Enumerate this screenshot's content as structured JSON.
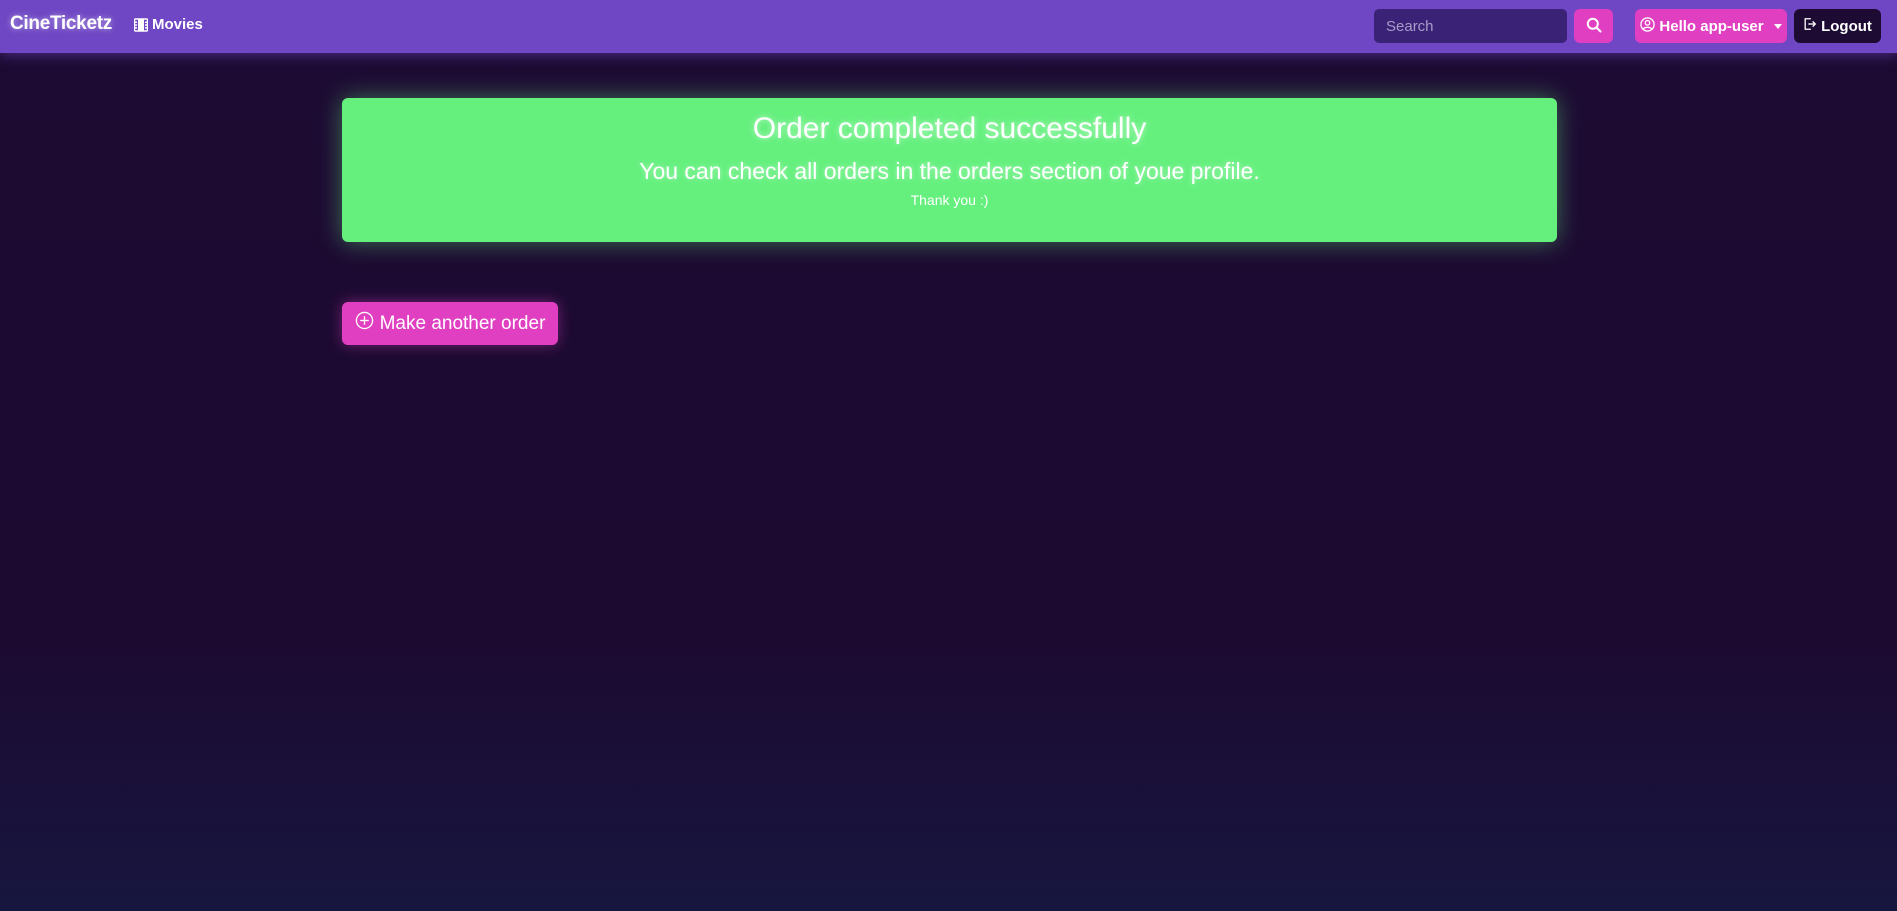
{
  "navbar": {
    "brand": "CineTicketz",
    "movies_link": "Movies",
    "movies_icon": "film-icon",
    "search": {
      "placeholder": "Search",
      "value": "",
      "icon": "search-icon"
    },
    "user_menu": {
      "label": "Hello app-user",
      "icon": "user-circle-icon"
    },
    "logout": {
      "label": "Logout",
      "icon": "logout-icon"
    }
  },
  "alert": {
    "title": "Order completed successfully",
    "subtitle": "You can check all orders in the orders section of youe profile.",
    "note": "Thank you :)"
  },
  "actions": {
    "make_another_order": "Make another order",
    "make_another_order_icon": "plus-circle-icon"
  },
  "colors": {
    "navbar": "#6f47c4",
    "background": "#1d0b33",
    "accent": "#e03fc1",
    "success": "#65f07e",
    "search_field": "#3a2377"
  }
}
